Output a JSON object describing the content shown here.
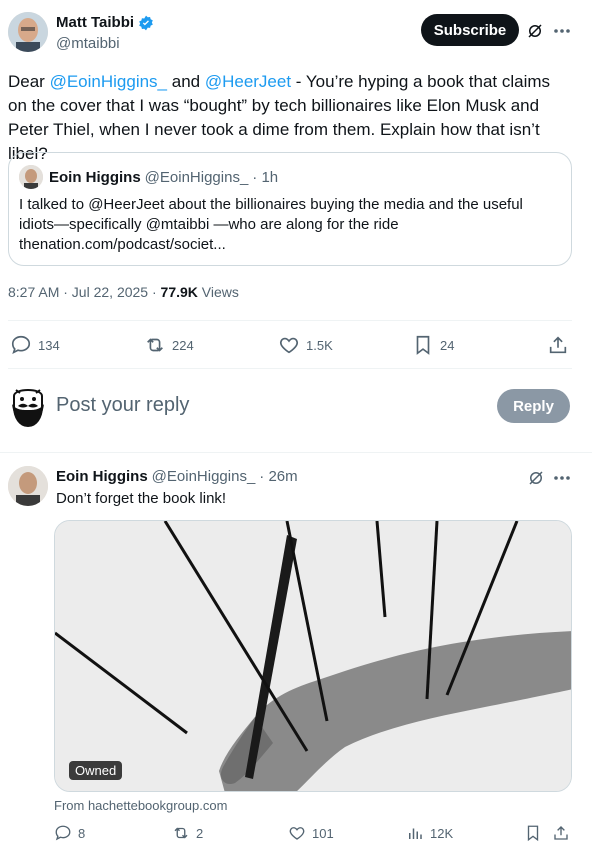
{
  "tweet": {
    "author_name": "Matt Taibbi",
    "author_handle": "@mtaibbi",
    "subscribe_label": "Subscribe",
    "text_1": "Dear ",
    "mention_1": "@EoinHiggins_",
    "text_2": " and ",
    "mention_2": "@HeerJeet",
    "text_3": " - You’re hyping a book that claims on the cover that I was “bought” by tech billionaires like Elon Musk and Peter Thiel, when I never took a dime from them. Explain how that isn’t libel?",
    "timestamp": "8:27 AM · Jul 22, 2025 · ",
    "views_count": "77.9K",
    "views_label": " Views"
  },
  "quote": {
    "author_name": "Eoin Higgins",
    "author_handle": "@EoinHiggins_",
    "age": "· 1h",
    "text": "I talked to @HeerJeet about the billionaires buying the media and the useful idiots—specifically @mtaibbi —who are along for the ride thenation.com/podcast/societ..."
  },
  "actions": {
    "replies": "134",
    "reposts": "224",
    "likes": "1.5K",
    "bookmarks": "24"
  },
  "composer": {
    "placeholder": "Post your reply",
    "reply_label": "Reply"
  },
  "reply": {
    "author_name": "Eoin Higgins",
    "author_handle": "@EoinHiggins_",
    "age": "· 26m",
    "text": "Don’t forget the book link!",
    "card_badge": "Owned",
    "card_source": "From hachettebookgroup.com",
    "replies": "8",
    "reposts": "2",
    "likes": "101",
    "views": "12K"
  },
  "colors": {
    "verified": "#1d9bf0",
    "link": "#1d9bf0",
    "reply_button": "#8b98a5",
    "subscribe_button": "#0f1419"
  },
  "icons": [
    "verified-badge-icon",
    "grok-icon",
    "more-icon",
    "reply-icon",
    "repost-icon",
    "like-icon",
    "bookmark-icon",
    "share-icon",
    "views-icon"
  ]
}
